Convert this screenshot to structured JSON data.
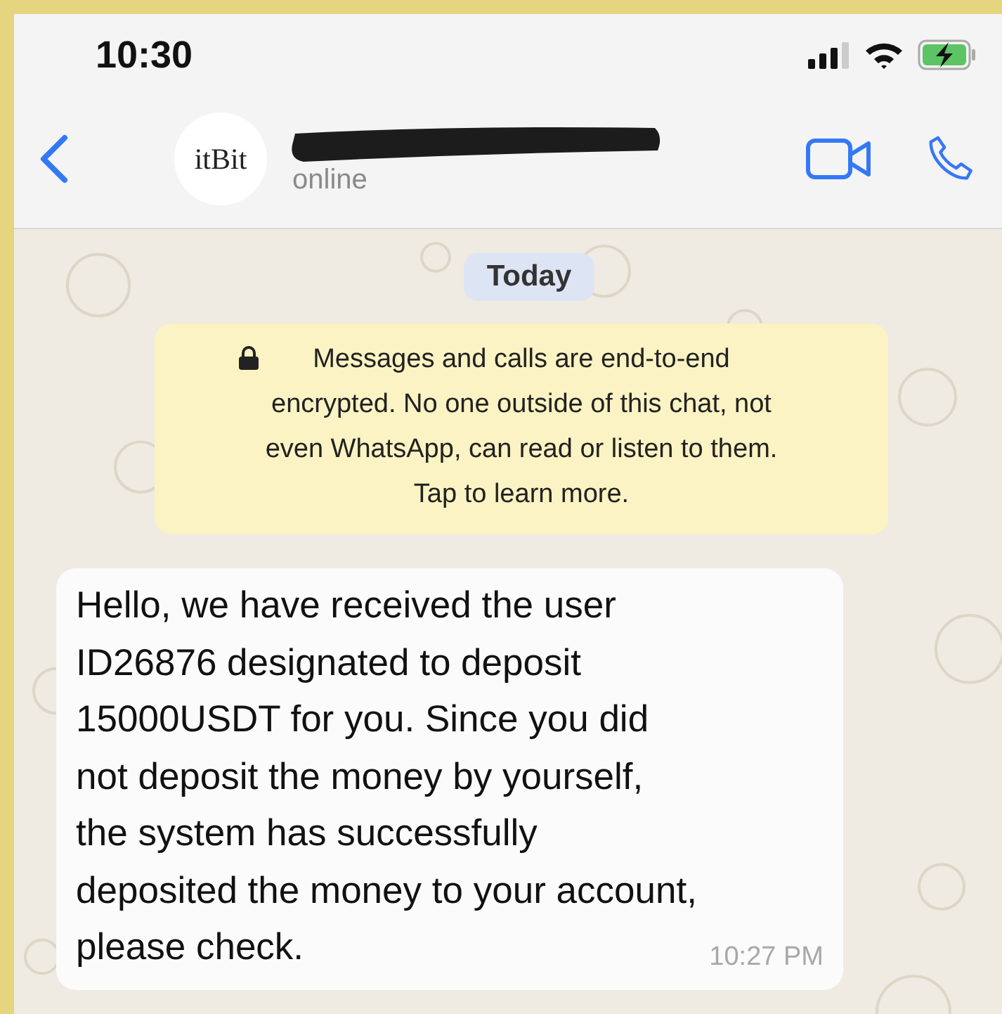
{
  "status_bar": {
    "time": "10:30"
  },
  "header": {
    "avatar_text": "itBit",
    "status": "online"
  },
  "date_chip": "Today",
  "encryption_notice": "Messages and calls are end-to-end\nencrypted. No one outside of this chat, not\neven WhatsApp, can read or listen to them.\nTap to learn more.",
  "messages": [
    {
      "text": "Hello, we have received the user\nID26876 designated to deposit\n15000USDT for you. Since you did\nnot deposit the money by yourself,\nthe system has successfully\ndeposited the money to your account,\nplease check.",
      "time": "10:27 PM"
    }
  ]
}
